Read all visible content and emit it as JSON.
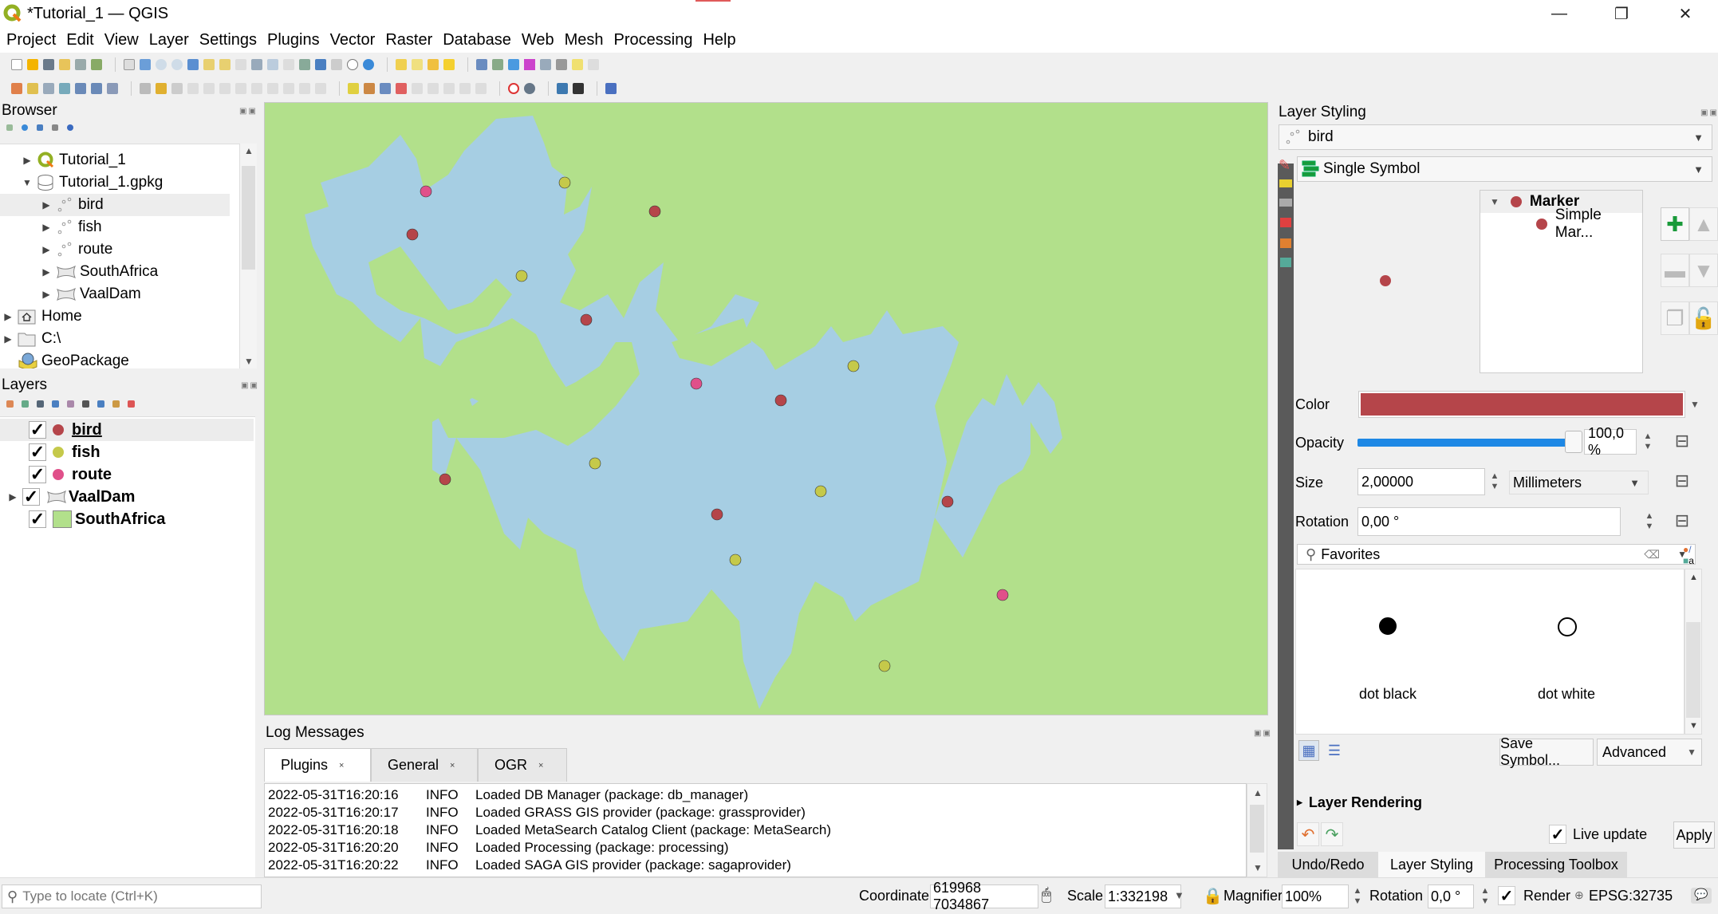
{
  "window": {
    "title": "*Tutorial_1 — QGIS",
    "minimize_icon": "minimize-icon",
    "restore_icon": "restore-icon",
    "close_icon": "close-icon"
  },
  "menu": [
    "Project",
    "Edit",
    "View",
    "Layer",
    "Settings",
    "Plugins",
    "Vector",
    "Raster",
    "Database",
    "Web",
    "Mesh",
    "Processing",
    "Help"
  ],
  "browser": {
    "title": "Browser",
    "items": [
      {
        "label": "Tutorial_1",
        "icon": "qgis-project-icon",
        "expand": "collapsed"
      },
      {
        "label": "Tutorial_1.gpkg",
        "icon": "database-icon",
        "expand": "expanded"
      },
      {
        "label": "bird",
        "icon": "point-layer-icon",
        "expand": "collapsed",
        "selected": true
      },
      {
        "label": "fish",
        "icon": "point-layer-icon",
        "expand": "collapsed"
      },
      {
        "label": "route",
        "icon": "point-layer-icon",
        "expand": "collapsed"
      },
      {
        "label": "SouthAfrica",
        "icon": "polygon-layer-icon",
        "expand": "collapsed"
      },
      {
        "label": "VaalDam",
        "icon": "polygon-layer-icon",
        "expand": "collapsed"
      },
      {
        "label": "Home",
        "icon": "home-folder-icon",
        "expand": "collapsed"
      },
      {
        "label": "C:\\",
        "icon": "folder-icon",
        "expand": "collapsed"
      },
      {
        "label": "GeoPackage",
        "icon": "geopackage-icon",
        "expand": "none"
      }
    ]
  },
  "layers": {
    "title": "Layers",
    "items": [
      {
        "label": "bird",
        "checked": true,
        "symbol": "point",
        "color": "#b5454a",
        "active": true
      },
      {
        "label": "fish",
        "checked": true,
        "symbol": "point",
        "color": "#c5c94a"
      },
      {
        "label": "route",
        "checked": true,
        "symbol": "point",
        "color": "#e0508a"
      },
      {
        "label": "VaalDam",
        "checked": true,
        "symbol": "polygon-icon",
        "color": "#dddddd",
        "expandable": true
      },
      {
        "label": "SouthAfrica",
        "checked": true,
        "symbol": "fill",
        "color": "#b2e08b"
      }
    ]
  },
  "map": {
    "land_color": "#b2e08b",
    "water_color": "#a6cee3",
    "layers": {
      "bird": "#b5454a",
      "fish": "#c5c94a",
      "route": "#e0508a"
    }
  },
  "log": {
    "title": "Log Messages",
    "tabs": [
      "Plugins",
      "General",
      "OGR"
    ],
    "active_tab": "Plugins",
    "rows": [
      {
        "ts": "2022-05-31T16:20:16",
        "level": "INFO",
        "msg": "Loaded DB Manager (package: db_manager)"
      },
      {
        "ts": "2022-05-31T16:20:17",
        "level": "INFO",
        "msg": "Loaded GRASS GIS provider (package: grassprovider)"
      },
      {
        "ts": "2022-05-31T16:20:18",
        "level": "INFO",
        "msg": "Loaded MetaSearch Catalog Client (package: MetaSearch)"
      },
      {
        "ts": "2022-05-31T16:20:20",
        "level": "INFO",
        "msg": "Loaded Processing (package: processing)"
      },
      {
        "ts": "2022-05-31T16:20:22",
        "level": "INFO",
        "msg": "Loaded SAGA GIS provider (package: sagaprovider)"
      }
    ]
  },
  "styling": {
    "title": "Layer Styling",
    "layer": "bird",
    "renderer": "Single Symbol",
    "symbol_tree": {
      "root": "Marker",
      "child": "Simple Mar..."
    },
    "symbol_color": "#b5454a",
    "color_label": "Color",
    "opacity_label": "Opacity",
    "opacity_value": "100,0 %",
    "opacity_fraction": 1.0,
    "size_label": "Size",
    "size_value": "2,00000",
    "size_unit": "Millimeters",
    "rotation_label": "Rotation",
    "rotation_value": "0,00 °",
    "search_value": "Favorites",
    "favorites": [
      {
        "label": "dot  black",
        "fill": "#000000"
      },
      {
        "label": "dot  white",
        "fill": "#ffffff"
      }
    ],
    "save_symbol": "Save Symbol...",
    "advanced": "Advanced",
    "layer_rendering": "Layer Rendering",
    "live_update": "Live update",
    "live_update_checked": true,
    "apply": "Apply"
  },
  "bottom_tabs": [
    "Undo/Redo",
    "Layer Styling",
    "Processing Toolbox"
  ],
  "bottom_active": "Layer Styling",
  "status": {
    "locator_placeholder": "Type to locate (Ctrl+K)",
    "coordinate_label": "Coordinate",
    "coordinate_value": "619968 7034867",
    "scale_label": "Scale",
    "scale_value": "1:332198",
    "magnifier_label": "Magnifier",
    "magnifier_value": "100%",
    "rotation_label": "Rotation",
    "rotation_value": "0,0 °",
    "render_label": "Render",
    "render_checked": true,
    "crs": "EPSG:32735"
  }
}
